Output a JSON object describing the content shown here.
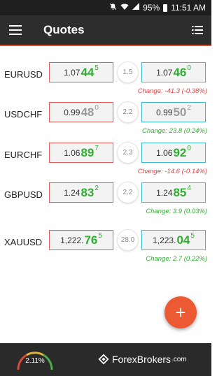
{
  "status_bar": {
    "battery": "95%",
    "time": "11:51 AM",
    "icons": [
      "silent-icon",
      "wifi-icon",
      "signal-icon",
      "battery-icon"
    ]
  },
  "app_bar": {
    "title": "Quotes",
    "menu_icon": "hamburger-menu-icon",
    "action_icon": "list-view-icon",
    "accent_color": "#e14b2c"
  },
  "colors": {
    "bid_border": "#e25b5b",
    "ask_border": "#3fb8cf",
    "up": "#2fae2f",
    "down": "#e24040",
    "neutral": "#9a9a9a"
  },
  "quotes": [
    {
      "symbol": "EURUSD",
      "bid": {
        "prefix": "1.07",
        "big": "44",
        "pip": "5",
        "dir": "up"
      },
      "spread": "1.5",
      "ask": {
        "prefix": "1.07",
        "big": "46",
        "pip": "0",
        "dir": "up"
      },
      "change": "Change: -41.3 (-0.38%)",
      "change_dir": "neg"
    },
    {
      "symbol": "USDCHF",
      "bid": {
        "prefix": "0.99",
        "big": "48",
        "pip": "0",
        "dir": "flat"
      },
      "spread": "2.2",
      "ask": {
        "prefix": "0.99",
        "big": "50",
        "pip": "2",
        "dir": "flat"
      },
      "change": "Change: 23.8 (0.24%)",
      "change_dir": "pos"
    },
    {
      "symbol": "EURCHF",
      "bid": {
        "prefix": "1.06",
        "big": "89",
        "pip": "7",
        "dir": "up"
      },
      "spread": "2.3",
      "ask": {
        "prefix": "1.06",
        "big": "92",
        "pip": "0",
        "dir": "up"
      },
      "change": "Change: -14.6 (-0.14%)",
      "change_dir": "neg"
    },
    {
      "symbol": "GBPUSD",
      "bid": {
        "prefix": "1.24",
        "big": "83",
        "pip": "2",
        "dir": "up"
      },
      "spread": "2.2",
      "ask": {
        "prefix": "1.24",
        "big": "85",
        "pip": "4",
        "dir": "up"
      },
      "change": "Change: 3.9 (0.03%)",
      "change_dir": "pos"
    },
    {
      "symbol": "XAUUSD",
      "bid": {
        "prefix": "1,222.",
        "big": "76",
        "pip": "5",
        "dir": "up"
      },
      "spread": "28.0",
      "ask": {
        "prefix": "1,223.",
        "big": "04",
        "pip": "5",
        "dir": "up"
      },
      "change": "Change: 2.7 (0.22%)",
      "change_dir": "pos"
    }
  ],
  "fab": {
    "icon": "plus-icon",
    "label": "+"
  },
  "footer": {
    "gauge_value": "2.11%",
    "brand_name": "ForexBrokers",
    "brand_suffix": ".com",
    "brand_icon": "forexbrokers-logo-icon"
  }
}
